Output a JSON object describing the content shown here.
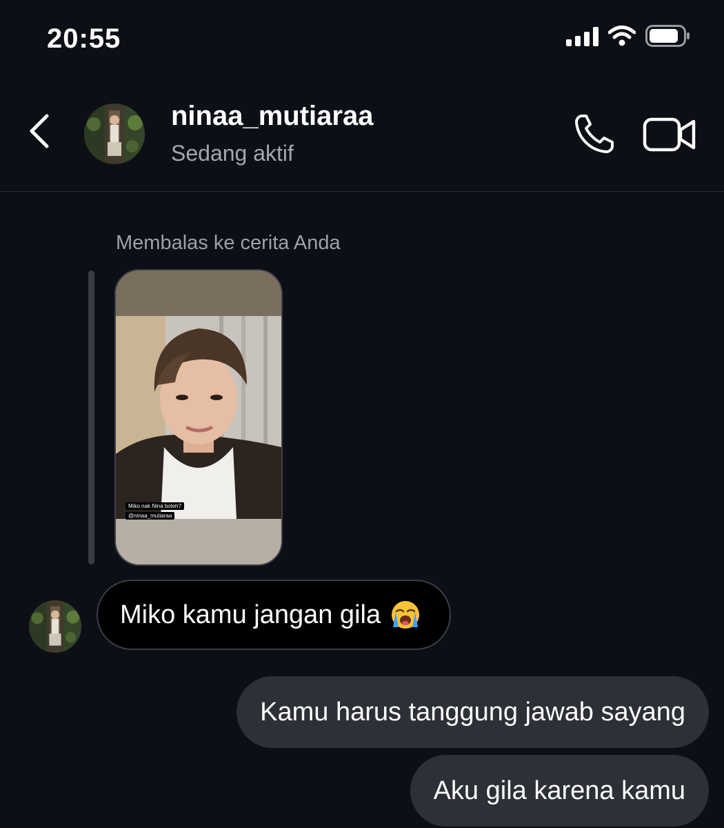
{
  "status_bar": {
    "time": "20:55",
    "icons": [
      "signal-icon",
      "wifi-icon",
      "battery-icon"
    ]
  },
  "header": {
    "back_icon": "chevron-left-icon",
    "username": "ninaa_mutiaraa",
    "presence": "Sedang aktif",
    "call_icon": "phone-icon",
    "video_icon": "video-camera-icon"
  },
  "reply": {
    "label": "Membalas ke cerita Anda",
    "story_tag_1": "Miko nak Nina boleh?",
    "story_tag_2": "@ninaa_mutiaraa"
  },
  "messages": {
    "incoming_1": "Miko kamu jangan gila",
    "incoming_1_emoji": "loudly-crying-face-emoji",
    "outgoing_1": "Kamu harus tanggung jawab sayang",
    "outgoing_2": "Aku gila karena kamu"
  },
  "colors": {
    "background": "#0d0f17",
    "bubble_incoming": "#000000",
    "bubble_outgoing": "#2e3038",
    "secondary_text": "#a4a7b0"
  }
}
